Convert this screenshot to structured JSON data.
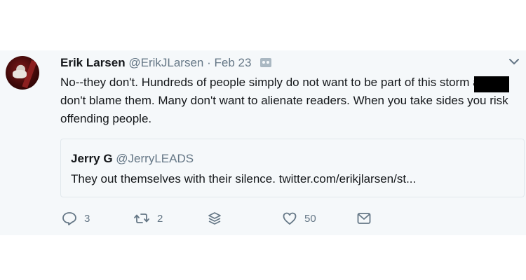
{
  "tweet": {
    "author_name": "Erik Larsen",
    "author_handle": "@ErikJLarsen",
    "separator": "·",
    "date": "Feb 23",
    "text": "No--they don't. Hundreds of people simply do not want to be part of this storm and I don't blame them. Many don't want to alienate readers. When you take sides you risk offending people."
  },
  "quoted_tweet": {
    "author_name": "Jerry G",
    "author_handle": "@JerryLEADS",
    "text": "They out themselves with their silence. twitter.com/erikjlarsen/st..."
  },
  "actions": {
    "reply_count": "3",
    "retweet_count": "2",
    "like_count": "50"
  },
  "icons": {
    "reply": "reply-icon",
    "retweet": "retweet-icon",
    "stack": "layers-icon",
    "like": "heart-icon",
    "message": "envelope-icon",
    "menu": "chevron-down-icon"
  },
  "colors": {
    "background": "#f5f8fa",
    "text": "#14171a",
    "secondary_text": "#657786",
    "border": "#e1e8ed",
    "redaction": "#000000"
  }
}
